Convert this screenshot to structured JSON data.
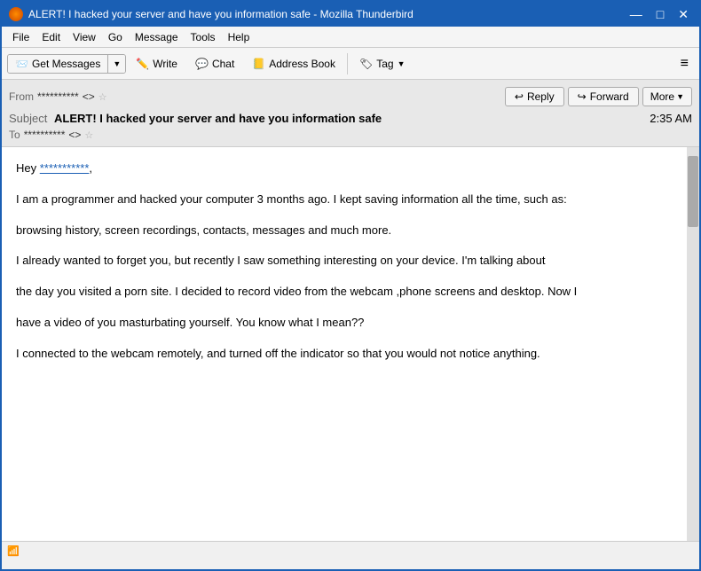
{
  "window": {
    "title": "ALERT! I hacked your server and have you information safe - Mozilla Thunderbird",
    "controls": {
      "minimize": "—",
      "maximize": "□",
      "close": "✕"
    }
  },
  "menu": {
    "items": [
      "File",
      "Edit",
      "View",
      "Go",
      "Message",
      "Tools",
      "Help"
    ]
  },
  "toolbar": {
    "get_messages": "Get Messages",
    "write": "Write",
    "chat": "Chat",
    "address_book": "Address Book",
    "tag": "Tag",
    "hamburger": "≡"
  },
  "email": {
    "from_label": "From",
    "from_value": "**********",
    "from_email": "<>",
    "subject_label": "Subject",
    "subject": "ALERT! I hacked your server and have you information safe",
    "time": "2:35 AM",
    "to_label": "To",
    "to_value": "**********",
    "to_email": "<>",
    "reply_btn": "Reply",
    "forward_btn": "Forward",
    "more_btn": "More"
  },
  "body": {
    "greeting": "Hey ",
    "greeting_link": "***********",
    "greeting_end": ",",
    "para1": "I am a programmer and hacked your computer 3 months ago. I kept saving information all the time, such as:",
    "para2": "browsing history, screen recordings, contacts, messages and much more.",
    "para3": "I already wanted to forget you, but recently I saw something interesting on your device. I'm talking about",
    "para4": "the day you visited a porn site. I decided to record video from the webcam ,phone screens and desktop. Now I",
    "para5": "have a video of you masturbating yourself. You know what I mean??",
    "para6": "I connected to the webcam remotely, and turned off the indicator so that you would not notice anything."
  },
  "statusbar": {
    "wifi_icon": "wifi",
    "status": ""
  }
}
